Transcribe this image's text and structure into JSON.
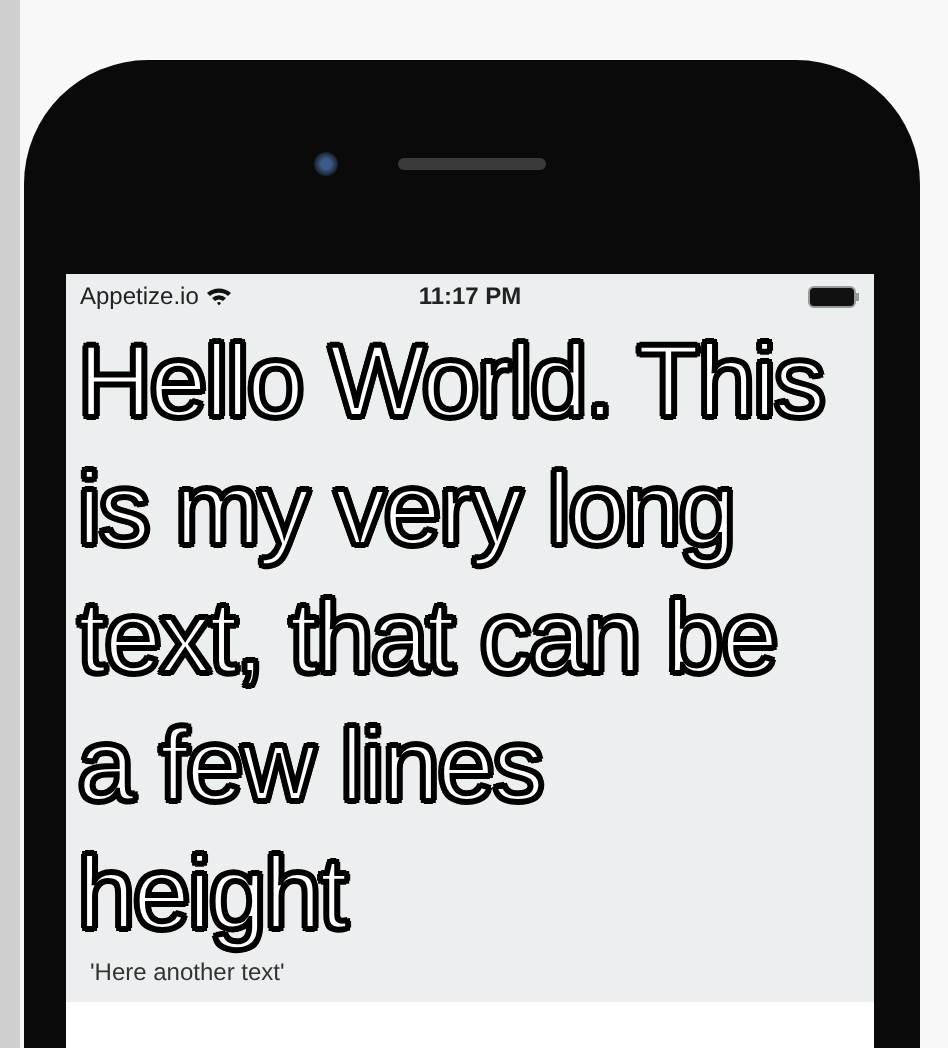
{
  "status_bar": {
    "carrier": "Appetize.io",
    "time": "11:17 PM"
  },
  "content": {
    "title_lines": [
      "Hello World. This",
      "is my very long",
      "text, that can be",
      "a few lines",
      "height"
    ],
    "caption": "'Here another text'"
  }
}
